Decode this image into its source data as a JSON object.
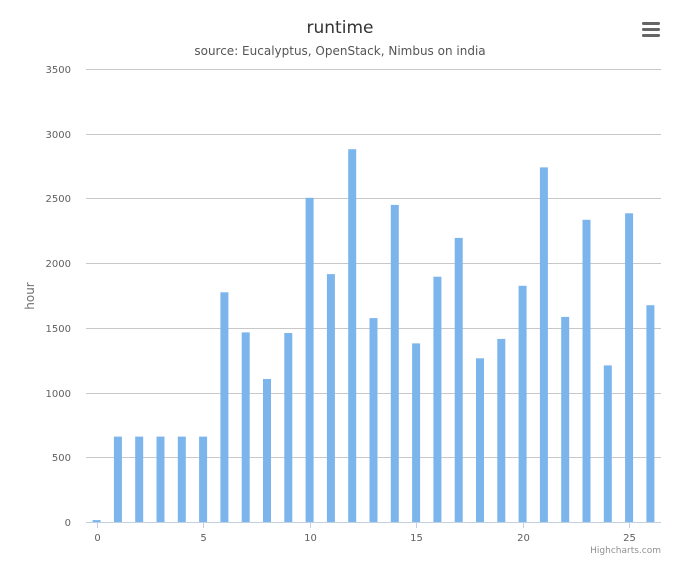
{
  "chart_data": {
    "type": "bar",
    "title": "runtime",
    "subtitle": "source: Eucalyptus, OpenStack, Nimbus on india",
    "xlabel": "",
    "ylabel": "hour",
    "x": [
      0,
      1,
      2,
      3,
      4,
      5,
      6,
      7,
      8,
      9,
      10,
      11,
      12,
      13,
      14,
      15,
      16,
      17,
      18,
      19,
      20,
      21,
      22,
      23,
      24,
      25,
      26
    ],
    "values": [
      15,
      660,
      660,
      660,
      660,
      660,
      1775,
      1465,
      1105,
      1460,
      2505,
      1915,
      2880,
      1575,
      2450,
      1380,
      1895,
      2195,
      1265,
      1415,
      1825,
      2740,
      1585,
      2335,
      1210,
      2385,
      1675
    ],
    "xticks": [
      0,
      5,
      10,
      15,
      20,
      25
    ],
    "yticks": [
      0,
      500,
      1000,
      1500,
      2000,
      2500,
      3000,
      3500
    ],
    "ylim": [
      0,
      3500
    ],
    "xlim": [
      -0.5,
      26.5
    ],
    "grid": true,
    "legend": "none",
    "bar_color": "#7cb5ec"
  },
  "credits": "Highcharts.com",
  "menu_icon": "hamburger-menu-icon"
}
